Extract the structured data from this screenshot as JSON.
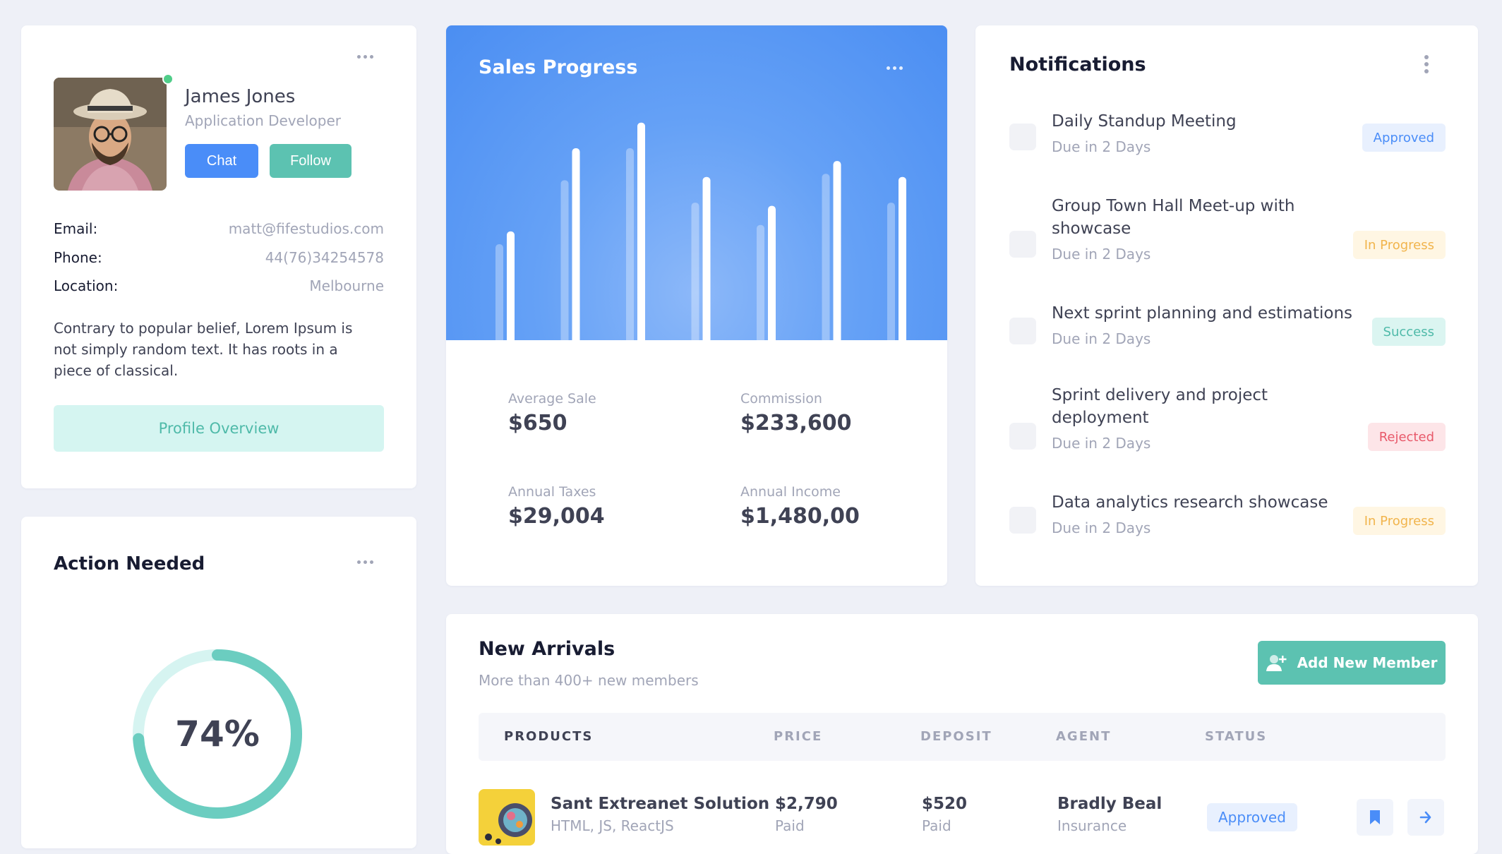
{
  "profile": {
    "name": "James Jones",
    "role": "Application Developer",
    "chat_label": "Chat",
    "follow_label": "Follow",
    "email_label": "Email:",
    "email": "matt@fifestudios.com",
    "phone_label": "Phone:",
    "phone": "44(76)34254578",
    "location_label": "Location:",
    "location": "Melbourne",
    "bio": "Contrary to popular belief, Lorem Ipsum is not simply random text. It has roots in a piece of classical.",
    "overview_label": "Profile Overview"
  },
  "action": {
    "title": "Action Needed",
    "progress_text": "74%",
    "progress_value": 74
  },
  "sales": {
    "title": "Sales Progress",
    "stats": [
      {
        "label": "Average Sale",
        "value": "$650"
      },
      {
        "label": "Commission",
        "value": "$233,600"
      },
      {
        "label": "Annual Taxes",
        "value": "$29,004"
      },
      {
        "label": "Annual Income",
        "value": "$1,480,00"
      }
    ]
  },
  "chart_data": {
    "type": "bar",
    "series": [
      {
        "values": [
          30,
          50,
          60,
          43,
          36,
          52,
          43
        ]
      },
      {
        "values": [
          34,
          60,
          68,
          51,
          42,
          56,
          51
        ]
      }
    ],
    "ylim": [
      0,
      75
    ]
  },
  "notifications": {
    "title": "Notifications",
    "items": [
      {
        "title": "Daily Standup Meeting",
        "due": "Due in 2 Days",
        "status": "Approved"
      },
      {
        "title": "Group Town Hall Meet-up with showcase",
        "due": "Due in 2 Days",
        "status": "In Progress"
      },
      {
        "title": "Next sprint planning and estimations",
        "due": "Due in 2 Days",
        "status": "Success"
      },
      {
        "title": "Sprint delivery and project deployment",
        "due": "Due in 2 Days",
        "status": "Rejected"
      },
      {
        "title": "Data analytics research showcase",
        "due": "Due in 2 Days",
        "status": "In Progress"
      }
    ]
  },
  "arrivals": {
    "title": "New Arrivals",
    "subtitle": "More than 400+ new members",
    "add_label": "Add New Member",
    "columns": [
      "PRODUCTS",
      "PRICE",
      "DEPOSIT",
      "AGENT",
      "STATUS"
    ],
    "rows": [
      {
        "product": "Sant Extreanet Solution",
        "tech": "HTML, JS, ReactJS",
        "price": "$2,790",
        "price_note": "Paid",
        "deposit": "$520",
        "deposit_note": "Paid",
        "agent": "Bradly Beal",
        "agent_note": "Insurance",
        "status": "Approved"
      }
    ]
  },
  "colors": {
    "primary": "#4a8df8",
    "teal": "#5cc2b1",
    "warning": "#f1b44c",
    "danger": "#e8596a"
  }
}
